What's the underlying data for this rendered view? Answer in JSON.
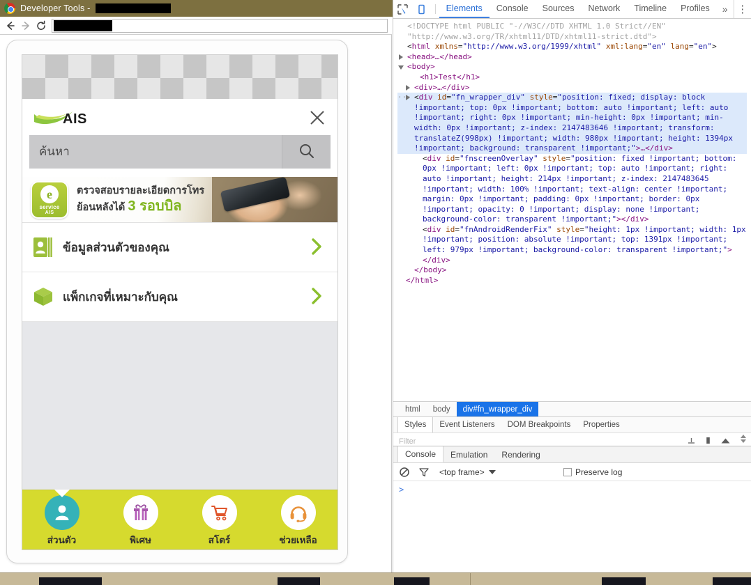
{
  "window": {
    "title_prefix": "Developer Tools - ",
    "title_redacted": true,
    "chrome_icon": "chrome-logo-icon",
    "minimize_label": "minimize-icon",
    "maximize_label": "maximize-icon",
    "close_label": "close-icon",
    "titlebar_color": "#7d7040"
  },
  "browser_toolbar": {
    "back_icon": "back-arrow-icon",
    "forward_icon": "forward-arrow-icon",
    "reload_icon": "reload-icon",
    "url_value": "",
    "url_redacted": true
  },
  "phone": {
    "checkerboard": "transparency-checkerboard",
    "header": {
      "logo_text": "AIS",
      "logo_icon": "ais-swoosh-icon",
      "close_icon": "close-icon",
      "search_placeholder": "ค้นหา",
      "search_value": "",
      "search_icon": "search-icon"
    },
    "promo": {
      "badge_letter": "e",
      "badge_service": "service",
      "badge_brand": "AIS",
      "line1": "ตรวจสอบรายละเอียดการโทร",
      "line2_prefix": "ย้อนหลังได้ ",
      "line2_highlight": "3 รอบบิล",
      "highlight_color": "#7fb51e",
      "photo": "hand-holding-phone-photo"
    },
    "menu_rows": [
      {
        "label": "ข้อมูลส่วนตัวของคุณ",
        "icon": "contact-card-icon",
        "chevron": "chevron-right-icon"
      },
      {
        "label": "แพ็กเกจที่เหมาะกับคุณ",
        "icon": "package-box-icon",
        "chevron": "chevron-right-icon"
      }
    ],
    "tabbar": {
      "background": "#d6da2e",
      "tabs": [
        {
          "label": "ส่วนตัว",
          "icon": "person-icon",
          "active": true,
          "circle_color": "#35b2b8"
        },
        {
          "label": "พิเศษ",
          "icon": "gift-icon",
          "active": false,
          "circle_color": "#ffffff"
        },
        {
          "label": "สโตร์",
          "icon": "shopping-cart-icon",
          "active": false,
          "circle_color": "#ffffff"
        },
        {
          "label": "ช่วยเหลือ",
          "icon": "headset-icon",
          "active": false,
          "circle_color": "#ffffff"
        }
      ]
    }
  },
  "devtools": {
    "inspect_icon": "inspect-element-icon",
    "device_icon": "device-toolbar-icon",
    "tabs": [
      {
        "label": "Elements",
        "active": true
      },
      {
        "label": "Console",
        "active": false
      },
      {
        "label": "Sources",
        "active": false
      },
      {
        "label": "Network",
        "active": false
      },
      {
        "label": "Timeline",
        "active": false
      },
      {
        "label": "Profiles",
        "active": false
      }
    ],
    "more_tabs": "»",
    "kebab": "⋮",
    "dom": {
      "doctype_line1": "<!DOCTYPE html PUBLIC \"-//W3C//DTD XHTML 1.0 Strict//EN\"",
      "doctype_line2": "\"http://www.w3.org/TR/xhtml11/DTD/xhtml11-strict.dtd\">",
      "html_open_tag": "html",
      "html_attrs": [
        {
          "name": "xmlns",
          "value": "\"http://www.w3.org/1999/xhtml\""
        },
        {
          "name": "xml:lang",
          "value": "\"en\""
        },
        {
          "name": "lang",
          "value": "\"en\""
        }
      ],
      "head_collapsed": "<head>…</head>",
      "body_open": "<body>",
      "h1_line": "<h1>Test</h1>",
      "div_collapsed": "<div>…</div>",
      "selected_div": {
        "tag": "div",
        "id_attr": "id",
        "id_value": "\"fn_wrapper_div\"",
        "style_attr": "style",
        "style_value": "\"position: fixed; display: block !important; top: 0px !important; bottom: auto !important; left: auto !important; right: 0px !important; min-height: 0px !important; min-width: 0px !important; z-index: 2147483646 !important; transform: translateZ(998px) !important; width: 980px !important; height: 1394px !important; background: transparent !important;\"",
        "tail": ">…</div>"
      },
      "overlay_div": {
        "tag": "div",
        "id_attr": "id",
        "id_value": "\"fnscreenOverlay\"",
        "style_attr": "style",
        "style_value": "\"position: fixed !important; bottom: 0px !important; left: 0px !important; top: auto !important; right: auto !important; height: 214px !important; z-index: 2147483645 !important; width: 100% !important; text-align: center !important; margin: 0px !important; padding: 0px !important; border: 0px !important; opacity: 0 !important; display: none !important; background-color: transparent !important;\"",
        "tail": "></div>"
      },
      "renderfix_div": {
        "tag": "div",
        "id_attr": "id",
        "id_value": "\"fnAndroidRenderFix\"",
        "style_attr": "style",
        "style_value": "\"height: 1px !important; width: 1px !important; position: absolute !important; top: 1391px !important; left: 979px !important; background-color: transparent !important;\"",
        "tail": "></div>"
      },
      "body_close": "</body>",
      "html_close": "</html>"
    },
    "breadcrumbs": [
      {
        "label": "html",
        "active": false
      },
      {
        "label": "body",
        "active": false
      },
      {
        "label": "div#fn_wrapper_div",
        "active": true
      }
    ],
    "sub_tabs": [
      {
        "label": "Styles",
        "active": true
      },
      {
        "label": "Event Listeners",
        "active": false
      },
      {
        "label": "DOM Breakpoints",
        "active": false
      },
      {
        "label": "Properties",
        "active": false
      }
    ],
    "styles_filter_placeholder": "Filter",
    "drawer": {
      "tabs": [
        {
          "label": "Console",
          "active": true
        },
        {
          "label": "Emulation",
          "active": false
        },
        {
          "label": "Rendering",
          "active": false
        }
      ],
      "clear_icon": "clear-console-icon",
      "filter_icon": "filter-icon",
      "frame_value": "<top frame>",
      "preserve_log_label": "Preserve log",
      "preserve_log_checked": false,
      "prompt": ">"
    }
  },
  "taskbar": {
    "background": "#c7b998",
    "items": 5
  }
}
